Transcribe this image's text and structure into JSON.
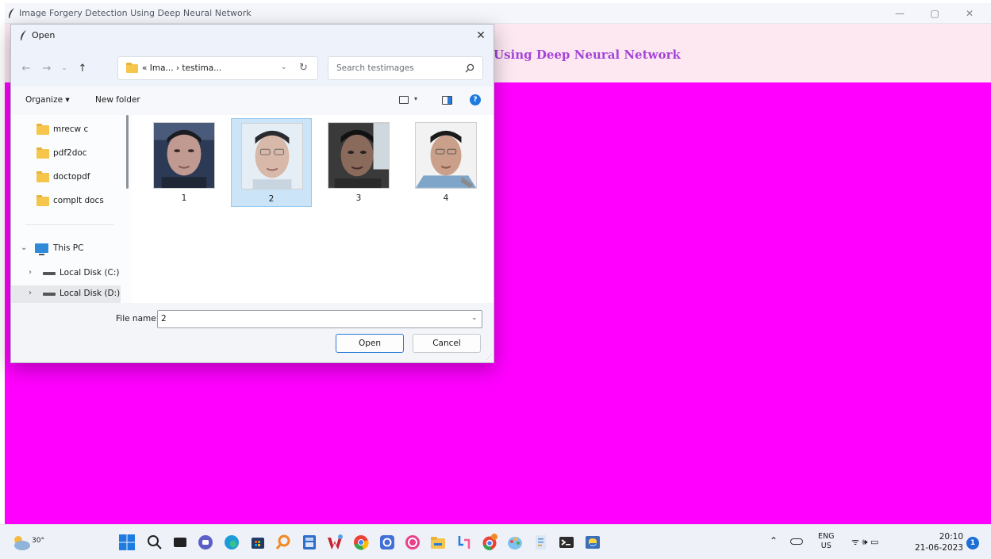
{
  "app": {
    "title": "Image Forgery Detection Using Deep Neural Network",
    "heading": "Using Deep Neural Network",
    "background_color": "#ff00ff",
    "header_color": "#fde8f2",
    "heading_color": "#a445d8"
  },
  "window_controls": {
    "minimize": "—",
    "maximize": "▢",
    "close": "✕"
  },
  "dialog": {
    "title": "Open",
    "close": "✕",
    "nav": {
      "back": "←",
      "forward": "→",
      "recent": "⌄",
      "up": "↑"
    },
    "address": {
      "path": "« Ima...  ›  testima...",
      "dropdown": "⌄",
      "refresh": "↻"
    },
    "search": {
      "placeholder": "Search testimages"
    },
    "toolbar": {
      "organize": "Organize ▾",
      "new_folder": "New folder",
      "view_dropdown": "▾",
      "help": "?"
    },
    "nav_pane": {
      "folders": [
        "mrecw c",
        "pdf2doc",
        "doctopdf",
        "complt docs"
      ],
      "this_pc": "This PC",
      "drives": [
        "Local Disk (C:)",
        "Local Disk (D:)"
      ],
      "expand_arrow": "⌄",
      "collapse_arrow": "›"
    },
    "files": [
      {
        "label": "1",
        "selected": false
      },
      {
        "label": "2",
        "selected": true
      },
      {
        "label": "3",
        "selected": false
      },
      {
        "label": "4",
        "selected": false
      }
    ],
    "file_name_label": "File name:",
    "file_name_value": "2",
    "file_name_dropdown": "⌄",
    "open_button": "Open",
    "cancel_button": "Cancel",
    "grip": "⋰"
  },
  "taskbar": {
    "weather_temp": "30°",
    "apps": [
      "windows-start",
      "search",
      "task-view",
      "teams-chat",
      "edge",
      "store",
      "search-app",
      "calculator",
      "wps-office",
      "chrome",
      "app-blue",
      "app-pink",
      "file-explorer",
      "snipping-tool",
      "chrome-alt",
      "paint",
      "notepad",
      "terminal",
      "python-idle"
    ],
    "tray_up": "⌃",
    "lang_top": "ENG",
    "lang_bottom": "US",
    "tray_icons": "ᯤ  🕪  ▭",
    "time": "20:10",
    "date": "21-06-2023",
    "notifications": "1"
  }
}
